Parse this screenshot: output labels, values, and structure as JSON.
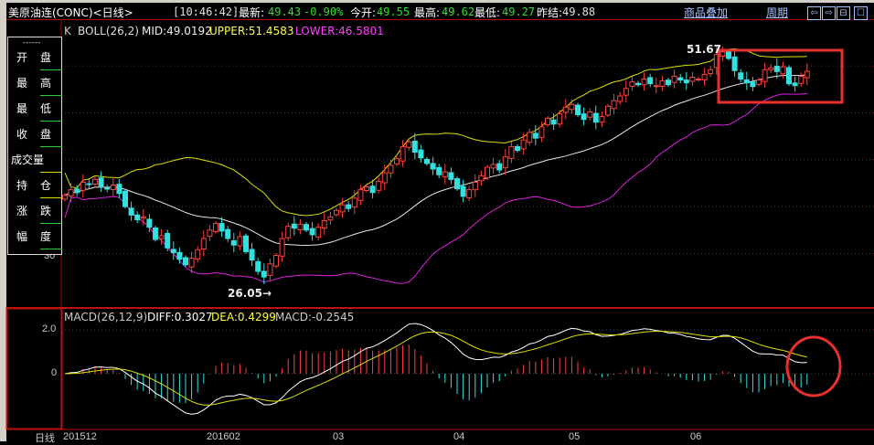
{
  "header": {
    "title": "美原油连(CONC)<日线>",
    "time": "[10:46:42]",
    "latest_label": "最新:",
    "latest_value": "49.43",
    "change_pct": "-0.90%",
    "open_label": "今开:",
    "open_value": "49.55",
    "high_label": "最高:",
    "high_value": "49.62",
    "low_label": "最低:",
    "low_value": "49.27",
    "prev_label": "昨结:",
    "prev_value": "49.88",
    "overlay_link": "商品叠加",
    "period_link": "周期",
    "buttons": [
      {
        "name": "scroll-left-icon",
        "glyph": "⇦"
      },
      {
        "name": "scroll-right-icon",
        "glyph": "⇨"
      },
      {
        "name": "split-panel-icon",
        "glyph": "⊟"
      },
      {
        "name": "maximize-icon",
        "glyph": "☐"
      }
    ]
  },
  "main_indicator": {
    "prefix": "K",
    "name": "BOLL(26,2)",
    "mid": "MID:49.0192",
    "upper": "UPPER:51.4583",
    "lower": "LOWER:46.5801"
  },
  "info_panel": {
    "dash": "------",
    "rows": [
      {
        "a": "开",
        "b": "盘"
      },
      {
        "a": "最",
        "b": "高"
      },
      {
        "a": "最",
        "b": "低"
      },
      {
        "a": "收",
        "b": "盘"
      },
      {
        "a": "成交量",
        "b": ""
      },
      {
        "a": "持",
        "b": "仓"
      },
      {
        "a": "涨",
        "b": "跌"
      },
      {
        "a": "幅",
        "b": "度"
      }
    ]
  },
  "price_axis": {
    "label_30": "30"
  },
  "macd_indicator": {
    "name": "MACD(26,12,9)",
    "diff": "DIFF:0.3027",
    "dea": "DEA:0.4299",
    "macd": "MACD:-0.2545"
  },
  "macd_axis": {
    "label_2": "2.0",
    "label_0": "0"
  },
  "x_axis": {
    "period": "日线",
    "labels": [
      "201512",
      "201602",
      "03",
      "04",
      "05",
      "06"
    ]
  },
  "annotations": {
    "high": "51.67",
    "low": "26.05→"
  },
  "colors": {
    "up": "#ff4040",
    "down": "#33e0e0",
    "mid": "#e8e8e8",
    "upper": "#e0e000",
    "lower": "#e020e0",
    "grid": "#a01010",
    "highlight": "#e83030"
  },
  "chart_data": {
    "type": "candlestick",
    "title": "美原油连(CONC) 日线",
    "x_range": [
      "201512",
      "201606"
    ],
    "y_range": [
      26.05,
      51.67
    ],
    "y_gridlines": [
      30,
      35,
      40,
      45,
      50
    ],
    "closes": [
      36.2,
      36.8,
      36.5,
      37.6,
      37.4,
      37.9,
      37.2,
      36.9,
      37.3,
      36.4,
      35.0,
      34.1,
      33.6,
      33.9,
      32.8,
      31.5,
      31.9,
      30.6,
      30.1,
      29.4,
      28.8,
      29.5,
      30.4,
      31.6,
      32.5,
      33.2,
      32.4,
      31.6,
      30.9,
      31.8,
      30.2,
      29.3,
      28.1,
      27.5,
      28.9,
      29.8,
      31.6,
      32.9,
      32.7,
      33.1,
      32.5,
      32.0,
      32.8,
      33.5,
      33.9,
      34.6,
      35.2,
      34.8,
      35.9,
      36.8,
      37.1,
      36.5,
      37.7,
      38.6,
      39.4,
      40.1,
      41.4,
      41.9,
      40.8,
      40.2,
      39.6,
      39.0,
      38.4,
      38.7,
      37.9,
      36.9,
      36.1,
      36.8,
      37.6,
      38.3,
      39.2,
      39.5,
      38.9,
      40.3,
      41.4,
      41.0,
      42.1,
      42.9,
      42.3,
      43.5,
      44.4,
      43.8,
      44.9,
      45.6,
      45.9,
      44.8,
      44.3,
      45.1,
      44.0,
      44.6,
      45.7,
      46.3,
      46.8,
      47.6,
      48.3,
      48.0,
      48.6,
      48.1,
      47.9,
      48.4,
      48.0,
      48.9,
      48.5,
      48.2,
      48.8,
      48.6,
      49.1,
      49.6,
      51.2,
      51.5,
      50.8,
      49.5,
      48.6,
      48.2,
      47.8,
      48.5,
      49.6,
      49.8,
      49.4,
      49.9,
      48.1,
      47.9,
      48.9,
      49.43
    ],
    "macd_range": [
      -2.5,
      2.5
    ]
  }
}
